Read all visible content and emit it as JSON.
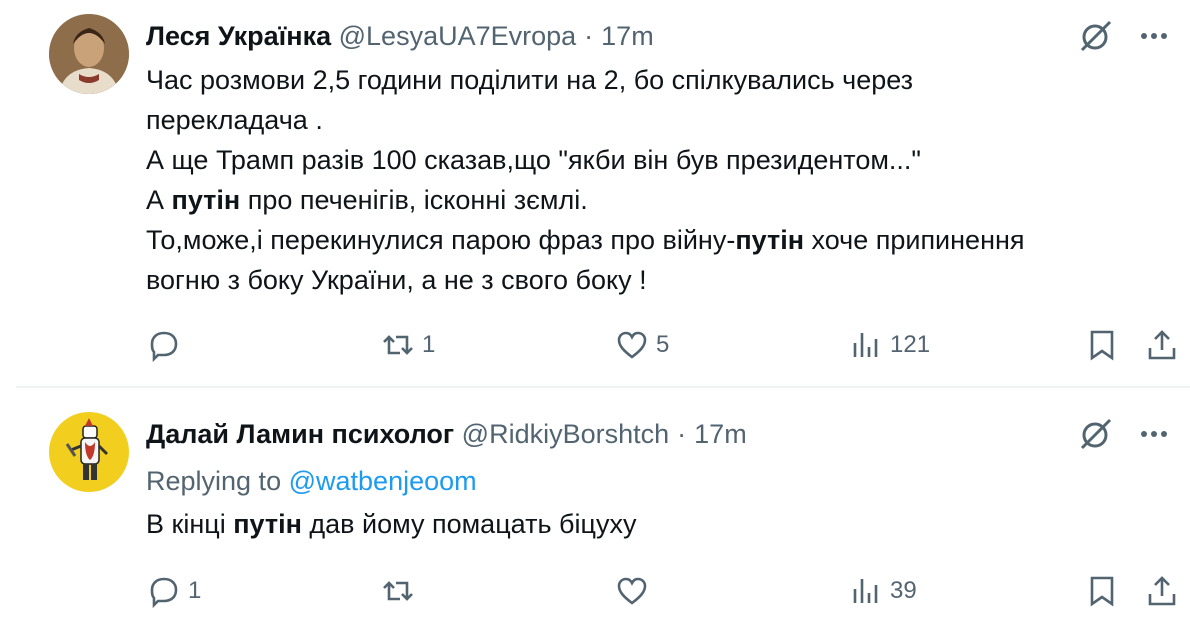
{
  "colors": {
    "text": "#0f1419",
    "muted": "#536471",
    "link": "#1d9bf0",
    "divider": "#eff3f4"
  },
  "tweets": [
    {
      "author_name": "Леся Українка",
      "handle": "@LesyaUA7Evropa",
      "separator": "·",
      "time": "17m",
      "lines": [
        [
          {
            "t": "Час розмови 2,5 години поділити на 2, бо спілкувались через",
            "b": false
          }
        ],
        [
          {
            "t": "перекладача .",
            "b": false
          }
        ],
        [
          {
            "t": "А ще Трамп разів 100 сказав,що \"якби він був президентом...\"",
            "b": false
          }
        ],
        [
          {
            "t": "А ",
            "b": false
          },
          {
            "t": "путін",
            "b": true
          },
          {
            "t": " про печенігів, ісконні зємлі.",
            "b": false
          }
        ],
        [
          {
            "t": "То,може,і перекинулися парою фраз про війну-",
            "b": false
          },
          {
            "t": "путін",
            "b": true
          },
          {
            "t": " хоче припинення",
            "b": false
          }
        ],
        [
          {
            "t": "вогню з боку України, а не з свого боку !",
            "b": false
          }
        ]
      ],
      "counts": {
        "replies": "",
        "reposts": "1",
        "likes": "5",
        "views": "121"
      }
    },
    {
      "author_name": "Далай Ламин психолог",
      "handle": "@RidkiyBorshtch",
      "separator": "·",
      "time": "17m",
      "replying_prefix": "Replying to",
      "replying_handle": "@watbenjeoom",
      "lines": [
        [
          {
            "t": "В кінці ",
            "b": false
          },
          {
            "t": "путін",
            "b": true
          },
          {
            "t": " дав йому помацать біцуху",
            "b": false
          }
        ]
      ],
      "counts": {
        "replies": "1",
        "reposts": "",
        "likes": "",
        "views": "39"
      }
    }
  ],
  "icons": {
    "grok": "grok-slash-circle-icon",
    "more": "more-dots-icon",
    "reply": "reply-bubble-icon",
    "repost": "repost-icon",
    "like": "heart-icon",
    "views": "views-bars-icon",
    "bookmark": "bookmark-icon",
    "share": "share-icon"
  }
}
